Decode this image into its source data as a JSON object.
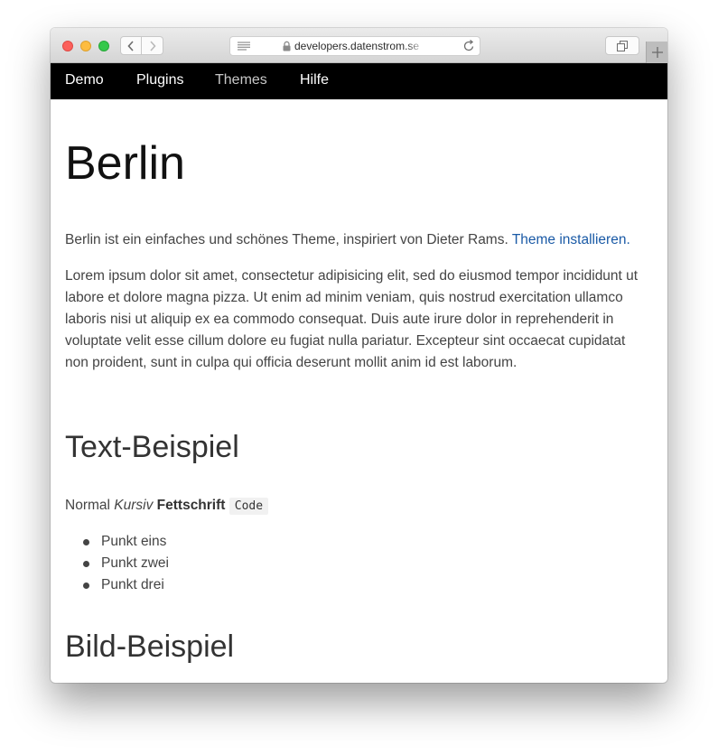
{
  "browser": {
    "url": "developers.datenstrom.se",
    "colors": {
      "close": "#fc605b",
      "minimize": "#fdbc40",
      "zoom": "#34c84a"
    },
    "icons": [
      "back-arrow-icon",
      "forward-arrow-icon",
      "reader-icon",
      "lock-icon",
      "reload-icon",
      "tabs-overview-icon",
      "plus-icon"
    ]
  },
  "site_nav": {
    "items": [
      {
        "label": "Demo"
      },
      {
        "label": "Plugins"
      },
      {
        "label": "Themes",
        "active": true
      },
      {
        "label": "Hilfe"
      }
    ],
    "background": "#000000"
  },
  "main": {
    "title": "Berlin",
    "intro_text": "Berlin ist ein einfaches und schönes Theme, inspiriert von Dieter Rams.",
    "intro_link": "Theme installieren.",
    "lorem": "Lorem ipsum dolor sit amet, consectetur adipisicing elit, sed do eiusmod tempor incididunt ut labore et dolore magna pizza. Ut enim ad minim veniam, quis nostrud exercitation ullamco laboris nisi ut aliquip ex ea commodo consequat. Duis aute irure dolor in reprehenderit in voluptate velit esse cillum dolore eu fugiat nulla pariatur. Excepteur sint occaecat cupidatat non proident, sunt in culpa qui officia deserunt mollit anim id est laborum.",
    "text_heading": "Text-Beispiel",
    "sample": {
      "normal": "Normal",
      "italic": "Kursiv",
      "bold": "Fettschrift",
      "code": "Code"
    },
    "list": [
      "Punkt eins",
      "Punkt zwei",
      "Punkt drei"
    ],
    "image_heading": "Bild-Beispiel",
    "link_color": "#1a5aa6"
  }
}
